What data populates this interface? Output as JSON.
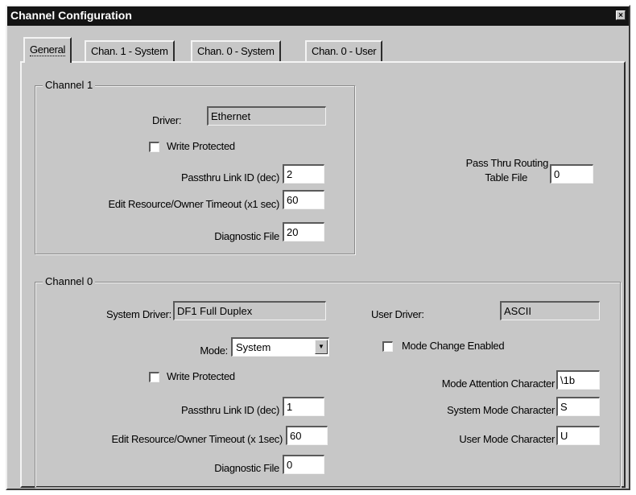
{
  "window": {
    "title": "Channel Configuration",
    "close_glyph": "×"
  },
  "tabs": [
    {
      "label": "General"
    },
    {
      "label": "Chan. 1 - System"
    },
    {
      "label": "Chan. 0 - System"
    },
    {
      "label": "Chan. 0 - User"
    }
  ],
  "channel1": {
    "group_label": "Channel 1",
    "driver_label": "Driver:",
    "driver_value": "Ethernet",
    "write_protected_label": "Write Protected",
    "passthru_label": "Passthru Link ID (dec)",
    "passthru_value": "2",
    "edit_timeout_label": "Edit Resource/Owner Timeout (x1 sec)",
    "edit_timeout_value": "60",
    "diagnostic_label": "Diagnostic File",
    "diagnostic_value": "20"
  },
  "routing": {
    "label_line1": "Pass Thru Routing",
    "label_line2": "Table File",
    "value": "0"
  },
  "channel0": {
    "group_label": "Channel 0",
    "system_driver_label": "System Driver:",
    "system_driver_value": "DF1 Full Duplex",
    "user_driver_label": "User Driver:",
    "user_driver_value": "ASCII",
    "mode_label": "Mode:",
    "mode_value": "System",
    "mode_change_label": "Mode Change Enabled",
    "write_protected_label": "Write Protected",
    "mode_attention_label": "Mode Attention Character",
    "mode_attention_value": "\\1b",
    "passthru_label": "Passthru Link ID (dec)",
    "passthru_value": "1",
    "system_mode_char_label": "System Mode Character",
    "system_mode_char_value": "S",
    "edit_timeout_label": "Edit Resource/Owner Timeout (x 1sec)",
    "edit_timeout_value": "60",
    "user_mode_char_label": "User Mode Character",
    "user_mode_char_value": "U",
    "diagnostic_label": "Diagnostic File",
    "diagnostic_value": "0"
  }
}
